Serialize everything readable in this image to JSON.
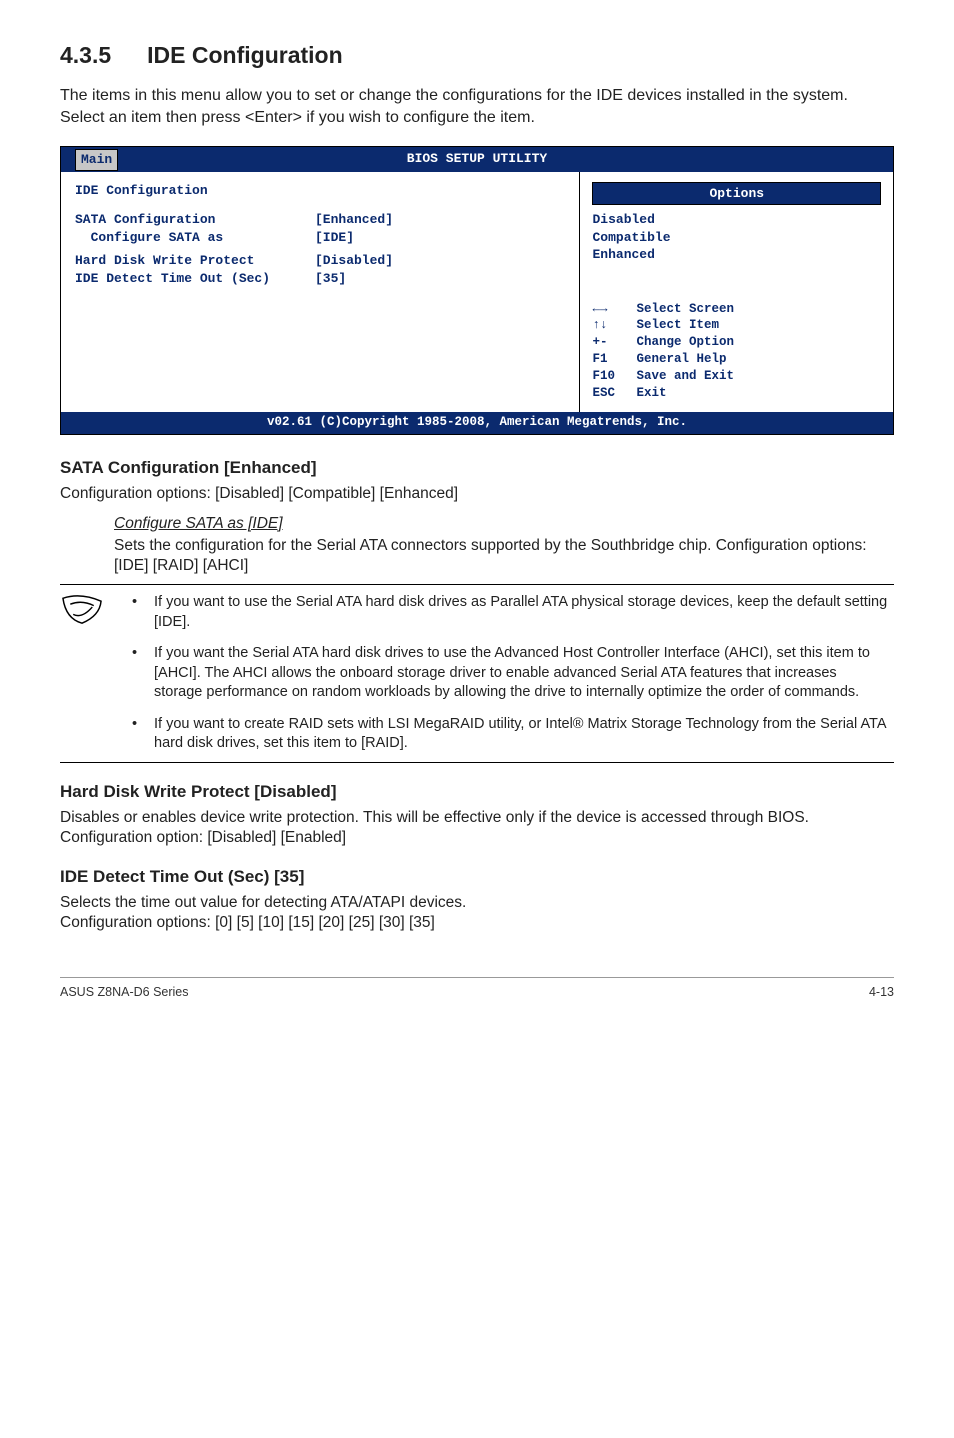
{
  "section": {
    "number": "4.3.5",
    "title": "IDE Configuration"
  },
  "intro": "The items in this menu allow you to set or change the configurations for the IDE devices installed in the system. Select an item then press <Enter> if you wish to configure the item.",
  "bios": {
    "header": "BIOS SETUP UTILITY",
    "tab": "Main",
    "left_title": "IDE Configuration",
    "rows": [
      {
        "label": "SATA Configuration",
        "value": "[Enhanced]"
      },
      {
        "label": "  Configure SATA as",
        "value": "[IDE]"
      },
      {
        "label": "Hard Disk Write Protect",
        "value": "[Disabled]"
      },
      {
        "label": "IDE Detect Time Out (Sec)",
        "value": "[35]"
      }
    ],
    "options_header": "Options",
    "options": [
      "Disabled",
      "Compatible",
      "Enhanced"
    ],
    "nav": [
      {
        "key": "←→",
        "action": "Select Screen"
      },
      {
        "key": "↑↓",
        "action": "Select Item"
      },
      {
        "key": "+-",
        "action": "Change Option"
      },
      {
        "key": "F1",
        "action": "General Help"
      },
      {
        "key": "F10",
        "action": "Save and Exit"
      },
      {
        "key": "ESC",
        "action": "Exit"
      }
    ],
    "footer": "v02.61 (C)Copyright 1985-2008, American Megatrends, Inc."
  },
  "sata_conf": {
    "heading": "SATA Configuration [Enhanced]",
    "text": "Configuration options: [Disabled] [Compatible] [Enhanced]",
    "sub_heading": "Configure SATA as [IDE]",
    "sub_text": "Sets the configuration for the Serial ATA connectors supported by the Southbridge chip. Configuration options: [IDE] [RAID] [AHCI]"
  },
  "notes": [
    "If you want to use the Serial ATA hard disk drives as Parallel ATA physical storage devices, keep the default setting [IDE].",
    "If you want the Serial ATA hard disk drives to use the Advanced Host Controller Interface (AHCI), set this item to [AHCI]. The AHCI allows the onboard storage driver to enable advanced Serial ATA features that increases storage performance on random workloads by allowing the drive to internally optimize the order of commands.",
    "If you want to create RAID sets with LSI MegaRAID utility, or Intel® Matrix Storage Technology from the Serial ATA hard disk drives, set this item to [RAID]."
  ],
  "hdwp": {
    "heading": "Hard Disk Write Protect [Disabled]",
    "text1": "Disables or enables device write protection. This will be effective only if the device is accessed through BIOS.",
    "text2": "Configuration option: [Disabled] [Enabled]"
  },
  "idet": {
    "heading": "IDE Detect Time Out (Sec) [35]",
    "text1": "Selects the time out value for detecting ATA/ATAPI devices.",
    "text2": "Configuration options: [0] [5] [10] [15] [20] [25] [30] [35]"
  },
  "footer": {
    "left": "ASUS Z8NA-D6 Series",
    "right": "4-13"
  }
}
